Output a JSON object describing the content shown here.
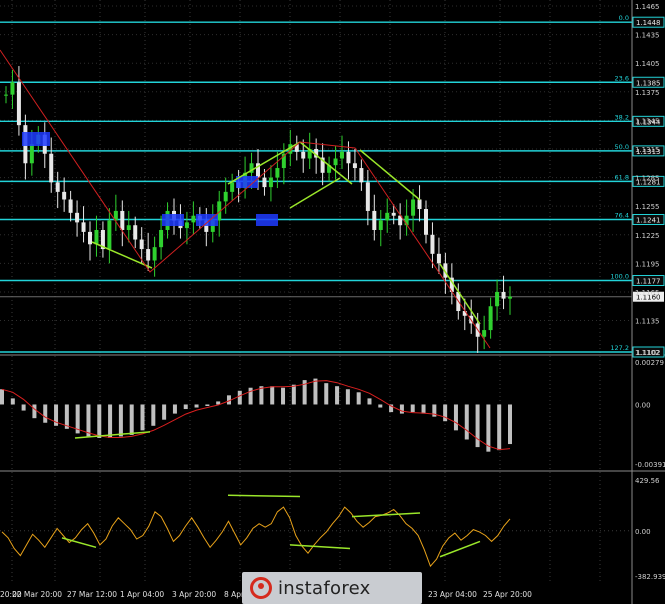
{
  "chart_data": [
    {
      "type": "line",
      "panel": "price",
      "ylim": [
        1.1102,
        1.1465
      ],
      "y_ticks": [
        "1.1465",
        "1.1435",
        "1.1405",
        "1.1375",
        "1.1345",
        "1.1315",
        "1.1285",
        "1.1255",
        "1.1225",
        "1.1195",
        "1.1165",
        "1.1135",
        "1.1102"
      ],
      "x_ticks": [
        "20:00",
        "22 Mar 20:00",
        "27 Mar 12:00",
        "1 Apr 04:00",
        "3 Apr 20:00",
        "8 Apr",
        "23 Apr 04:00",
        "25 Apr 20:00"
      ],
      "fib_levels": [
        {
          "ratio": "0.0",
          "price": "1.1448"
        },
        {
          "ratio": "23.6",
          "price": "1.1385"
        },
        {
          "ratio": "38.2",
          "price": "1.1344"
        },
        {
          "ratio": "50.0",
          "price": "1.1313"
        },
        {
          "ratio": "61.8",
          "price": "1.1281"
        },
        {
          "ratio": "76.4",
          "price": "1.1241"
        },
        {
          "ratio": "100.0",
          "price": "1.1177"
        },
        {
          "ratio": "127.2",
          "price": "1.1102"
        }
      ],
      "current_price": "1.1160",
      "series": [
        {
          "values": [
            1.1372,
            1.1385,
            1.134,
            1.13,
            1.132,
            1.133,
            1.131,
            1.128,
            1.127,
            1.1262,
            1.1248,
            1.1238,
            1.1228,
            1.1215,
            1.123,
            1.121,
            1.124,
            1.125,
            1.123,
            1.1235,
            1.122,
            1.121,
            1.1198,
            1.1212,
            1.123,
            1.125,
            1.124,
            1.1232,
            1.1238,
            1.1245,
            1.124,
            1.1228,
            1.124,
            1.126,
            1.127,
            1.128,
            1.1274,
            1.129,
            1.13,
            1.1285,
            1.1275,
            1.1285,
            1.1295,
            1.131,
            1.132,
            1.1312,
            1.1305,
            1.1315,
            1.1306,
            1.129,
            1.1298,
            1.1305,
            1.1312,
            1.13,
            1.1295,
            1.128,
            1.125,
            1.123,
            1.124,
            1.1248,
            1.1245,
            1.1235,
            1.1245,
            1.1262,
            1.1252,
            1.1225,
            1.1205,
            1.1195,
            1.118,
            1.1165,
            1.1145,
            1.114,
            1.1132,
            1.1118,
            1.1125,
            1.115,
            1.1165,
            1.1158,
            1.116
          ]
        }
      ],
      "overlays": {
        "blue_boxes": 5,
        "green_trendlines": 6,
        "red_zigzag": 1
      }
    },
    {
      "type": "bar",
      "panel": "macd",
      "y_ticks": [
        "0.00279",
        "0.00",
        "-0.00391"
      ],
      "values": [
        0.001,
        0.0004,
        -0.0004,
        -0.0009,
        -0.0012,
        -0.0014,
        -0.0016,
        -0.0019,
        -0.0021,
        -0.0022,
        -0.0022,
        -0.0021,
        -0.002,
        -0.0017,
        -0.0014,
        -0.001,
        -0.0006,
        -0.0003,
        -0.0002,
        -0.0001,
        0.0002,
        0.0006,
        0.0009,
        0.0011,
        0.0012,
        0.0012,
        0.0011,
        0.0013,
        0.0016,
        0.0017,
        0.0014,
        0.0012,
        0.001,
        0.0008,
        0.0004,
        -0.0002,
        -0.0005,
        -0.0006,
        -0.0005,
        -0.0006,
        -0.0008,
        -0.0011,
        -0.0017,
        -0.0023,
        -0.0028,
        -0.0031,
        -0.003,
        -0.0026
      ],
      "signal_line": "red",
      "histogram_color": "silver"
    },
    {
      "type": "line",
      "panel": "oscillator",
      "y_ticks": [
        "429.56",
        "0.00",
        "-382.939"
      ],
      "series": [
        {
          "color": "orange",
          "values": [
            -10,
            -60,
            -150,
            -210,
            -120,
            -30,
            -80,
            -140,
            -60,
            20,
            -40,
            -100,
            -60,
            10,
            60,
            -20,
            -120,
            -70,
            40,
            110,
            60,
            10,
            -70,
            -40,
            40,
            160,
            120,
            20,
            -90,
            -40,
            40,
            110,
            30,
            -60,
            -140,
            -80,
            -10,
            80,
            -20,
            -120,
            -60,
            20,
            60,
            30,
            60,
            160,
            200,
            110,
            -40,
            -130,
            -190,
            -120,
            -60,
            -10,
            60,
            120,
            200,
            150,
            80,
            30,
            70,
            120,
            130,
            150,
            180,
            130,
            60,
            20,
            -40,
            -160,
            -300,
            -240,
            -130,
            -60,
            -20,
            -80,
            -40,
            10,
            -10,
            -40,
            -90,
            -40,
            40,
            100
          ]
        }
      ],
      "divergence_lines": "green"
    }
  ],
  "watermark": {
    "logo_icon": "instaforex-logo-icon",
    "text": "instaforex"
  }
}
